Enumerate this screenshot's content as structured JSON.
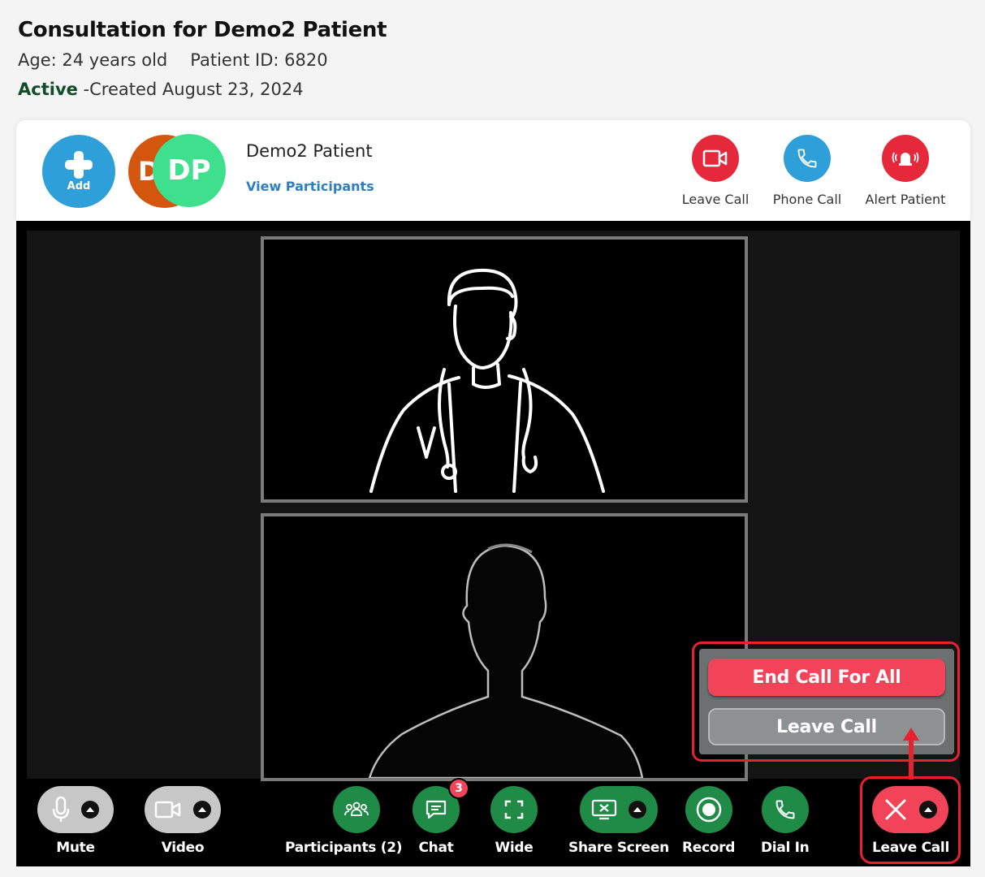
{
  "header": {
    "title": "Consultation for Demo2 Patient",
    "age": "Age: 24 years old",
    "patient_id": "Patient ID: 6820",
    "status": "Active",
    "created": " -Created August 23, 2024"
  },
  "card": {
    "add_label": "Add",
    "avatar_back_initial": "D",
    "avatar_initials": "DP",
    "patient_name": "Demo2 Patient",
    "view_participants": "View Participants",
    "actions": [
      {
        "label": "Leave Call",
        "icon": "video-icon",
        "color": "#e5283a"
      },
      {
        "label": "Phone Call",
        "icon": "phone-icon",
        "color": "#2e9fd8"
      },
      {
        "label": "Alert Patient",
        "icon": "alarm-icon",
        "color": "#e5283a"
      }
    ]
  },
  "popup": {
    "end_all": "End Call For All",
    "leave": "Leave Call"
  },
  "toolbar": {
    "mute": "Mute",
    "video": "Video",
    "participants": "Participants (2)",
    "chat": "Chat",
    "chat_badge": "3",
    "wide": "Wide",
    "share_screen": "Share Screen",
    "record": "Record",
    "dial_in": "Dial In",
    "leave_call": "Leave Call"
  },
  "colors": {
    "brand_blue": "#2e9fd8",
    "control_green": "#1f8b46",
    "danger_red": "#f14458",
    "active_green": "#0e4d2a"
  }
}
